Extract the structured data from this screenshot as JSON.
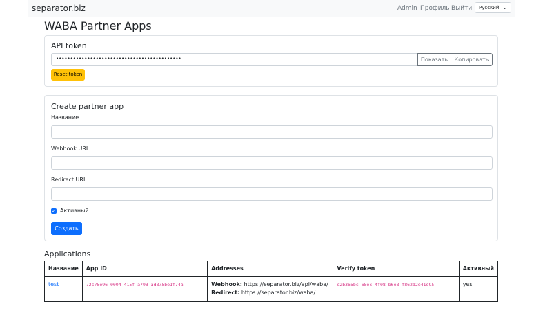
{
  "navbar": {
    "brand": "separator.biz",
    "links": [
      "Admin",
      "Профиль",
      "Выйти"
    ],
    "language": "Русский"
  },
  "page_title": "WABA Partner Apps",
  "api_token": {
    "title": "API token",
    "masked_value": "••••••••••••••••••••••••••••••••••••••••••••",
    "show_label": "Показать",
    "copy_label": "Копировать",
    "reset_label": "Reset token"
  },
  "create_form": {
    "title": "Create partner app",
    "name_label": "Название",
    "name_value": "",
    "webhook_label": "Webhook URL",
    "webhook_value": "",
    "redirect_label": "Redirect URL",
    "redirect_value": "",
    "active_label": "Активный",
    "active_checked": true,
    "submit_label": "Создать"
  },
  "applications": {
    "title": "Applications",
    "columns": [
      "Название",
      "App ID",
      "Addresses",
      "Verify token",
      "Активный"
    ],
    "rows": [
      {
        "name": "test",
        "app_id": "72c75e96-0004-415f-a793-ad875be1f74a",
        "webhook_label": "Webhook:",
        "webhook": "https://separator.biz/api/waba/",
        "redirect_label": "Redirect:",
        "redirect": "https://separator.biz/waba/",
        "verify_token": "e2b365bc-65ec-4f08-b6e8-f862d2e41e95",
        "active": "yes"
      }
    ]
  },
  "colors": {
    "primary": "#0d6efd",
    "warning": "#ffc107",
    "code": "#d63384",
    "navbar_bg": "#f8f9fa"
  }
}
